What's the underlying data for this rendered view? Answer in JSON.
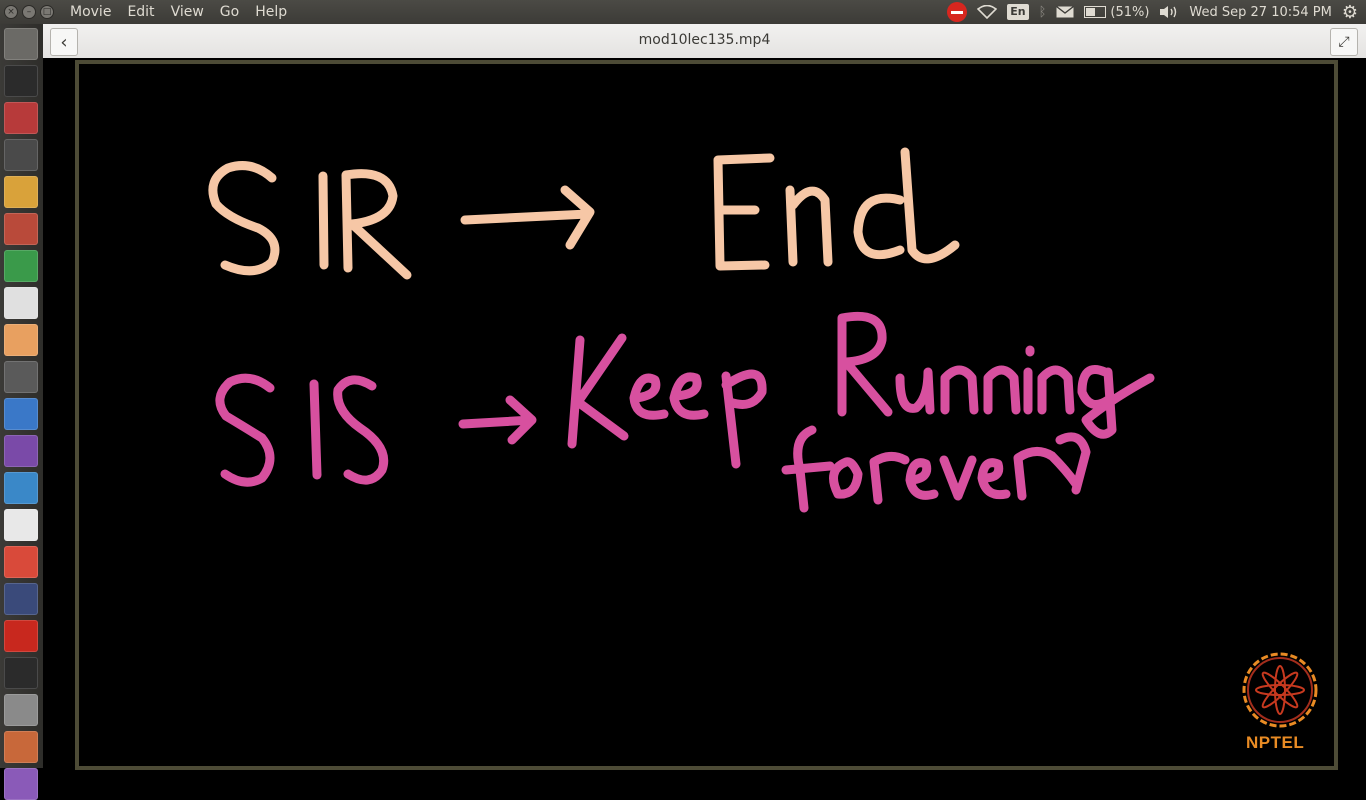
{
  "topbar": {
    "menus": [
      "Movie",
      "Edit",
      "View",
      "Go",
      "Help"
    ],
    "keyboard": "En",
    "battery": "(51%)",
    "clock": "Wed Sep 27 10:54 PM"
  },
  "player": {
    "title": "mod10lec135.mp4"
  },
  "slide": {
    "line1_left": "SIR",
    "line1_right": "End",
    "line2_left": "SIS",
    "line2_right_a": "Keep Running",
    "line2_right_b": "forever",
    "logo_text": "NPTEL"
  },
  "colors": {
    "line1": "#f6c7a6",
    "line2": "#d7509f",
    "logo": "#e98b24"
  },
  "launcher_icons": [
    "dash-icon",
    "terminal-icon",
    "files-icon",
    "sublime-icon",
    "chrome-icon",
    "settings-icon",
    "spreadsheet-icon",
    "pdf-icon",
    "presentation-icon",
    "video-editor-icon",
    "r-icon",
    "media-icon",
    "document-icon",
    "text-editor-icon",
    "gmail-icon",
    "ipython-icon",
    "opera-icon",
    "gimp-icon",
    "scanner-icon",
    "image-viewer-icon",
    "updates-icon"
  ]
}
